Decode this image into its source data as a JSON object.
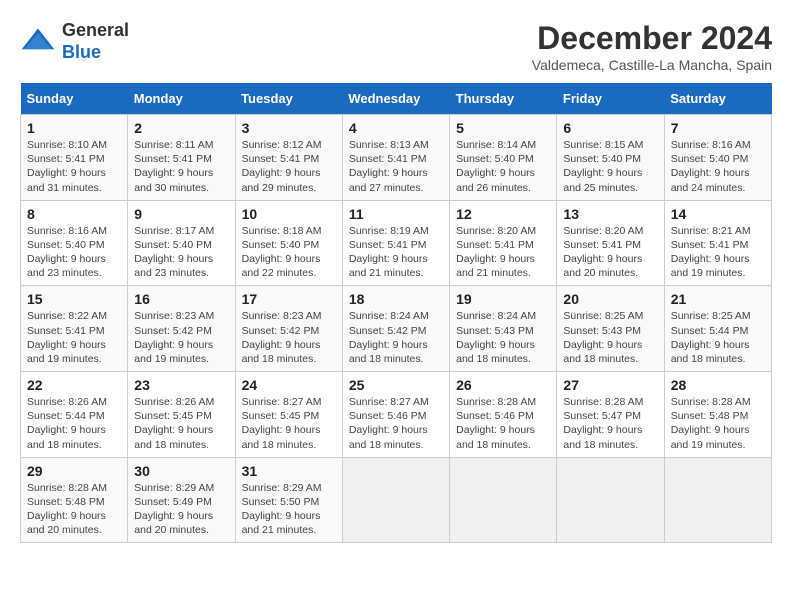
{
  "header": {
    "logo_general": "General",
    "logo_blue": "Blue",
    "month_year": "December 2024",
    "location": "Valdemeca, Castille-La Mancha, Spain"
  },
  "days_of_week": [
    "Sunday",
    "Monday",
    "Tuesday",
    "Wednesday",
    "Thursday",
    "Friday",
    "Saturday"
  ],
  "weeks": [
    [
      {
        "day": "1",
        "sunrise": "8:10 AM",
        "sunset": "5:41 PM",
        "daylight": "9 hours and 31 minutes."
      },
      {
        "day": "2",
        "sunrise": "8:11 AM",
        "sunset": "5:41 PM",
        "daylight": "9 hours and 30 minutes."
      },
      {
        "day": "3",
        "sunrise": "8:12 AM",
        "sunset": "5:41 PM",
        "daylight": "9 hours and 29 minutes."
      },
      {
        "day": "4",
        "sunrise": "8:13 AM",
        "sunset": "5:41 PM",
        "daylight": "9 hours and 27 minutes."
      },
      {
        "day": "5",
        "sunrise": "8:14 AM",
        "sunset": "5:40 PM",
        "daylight": "9 hours and 26 minutes."
      },
      {
        "day": "6",
        "sunrise": "8:15 AM",
        "sunset": "5:40 PM",
        "daylight": "9 hours and 25 minutes."
      },
      {
        "day": "7",
        "sunrise": "8:16 AM",
        "sunset": "5:40 PM",
        "daylight": "9 hours and 24 minutes."
      }
    ],
    [
      {
        "day": "8",
        "sunrise": "8:16 AM",
        "sunset": "5:40 PM",
        "daylight": "9 hours and 23 minutes."
      },
      {
        "day": "9",
        "sunrise": "8:17 AM",
        "sunset": "5:40 PM",
        "daylight": "9 hours and 23 minutes."
      },
      {
        "day": "10",
        "sunrise": "8:18 AM",
        "sunset": "5:40 PM",
        "daylight": "9 hours and 22 minutes."
      },
      {
        "day": "11",
        "sunrise": "8:19 AM",
        "sunset": "5:41 PM",
        "daylight": "9 hours and 21 minutes."
      },
      {
        "day": "12",
        "sunrise": "8:20 AM",
        "sunset": "5:41 PM",
        "daylight": "9 hours and 21 minutes."
      },
      {
        "day": "13",
        "sunrise": "8:20 AM",
        "sunset": "5:41 PM",
        "daylight": "9 hours and 20 minutes."
      },
      {
        "day": "14",
        "sunrise": "8:21 AM",
        "sunset": "5:41 PM",
        "daylight": "9 hours and 19 minutes."
      }
    ],
    [
      {
        "day": "15",
        "sunrise": "8:22 AM",
        "sunset": "5:41 PM",
        "daylight": "9 hours and 19 minutes."
      },
      {
        "day": "16",
        "sunrise": "8:23 AM",
        "sunset": "5:42 PM",
        "daylight": "9 hours and 19 minutes."
      },
      {
        "day": "17",
        "sunrise": "8:23 AM",
        "sunset": "5:42 PM",
        "daylight": "9 hours and 18 minutes."
      },
      {
        "day": "18",
        "sunrise": "8:24 AM",
        "sunset": "5:42 PM",
        "daylight": "9 hours and 18 minutes."
      },
      {
        "day": "19",
        "sunrise": "8:24 AM",
        "sunset": "5:43 PM",
        "daylight": "9 hours and 18 minutes."
      },
      {
        "day": "20",
        "sunrise": "8:25 AM",
        "sunset": "5:43 PM",
        "daylight": "9 hours and 18 minutes."
      },
      {
        "day": "21",
        "sunrise": "8:25 AM",
        "sunset": "5:44 PM",
        "daylight": "9 hours and 18 minutes."
      }
    ],
    [
      {
        "day": "22",
        "sunrise": "8:26 AM",
        "sunset": "5:44 PM",
        "daylight": "9 hours and 18 minutes."
      },
      {
        "day": "23",
        "sunrise": "8:26 AM",
        "sunset": "5:45 PM",
        "daylight": "9 hours and 18 minutes."
      },
      {
        "day": "24",
        "sunrise": "8:27 AM",
        "sunset": "5:45 PM",
        "daylight": "9 hours and 18 minutes."
      },
      {
        "day": "25",
        "sunrise": "8:27 AM",
        "sunset": "5:46 PM",
        "daylight": "9 hours and 18 minutes."
      },
      {
        "day": "26",
        "sunrise": "8:28 AM",
        "sunset": "5:46 PM",
        "daylight": "9 hours and 18 minutes."
      },
      {
        "day": "27",
        "sunrise": "8:28 AM",
        "sunset": "5:47 PM",
        "daylight": "9 hours and 18 minutes."
      },
      {
        "day": "28",
        "sunrise": "8:28 AM",
        "sunset": "5:48 PM",
        "daylight": "9 hours and 19 minutes."
      }
    ],
    [
      {
        "day": "29",
        "sunrise": "8:28 AM",
        "sunset": "5:48 PM",
        "daylight": "9 hours and 20 minutes."
      },
      {
        "day": "30",
        "sunrise": "8:29 AM",
        "sunset": "5:49 PM",
        "daylight": "9 hours and 20 minutes."
      },
      {
        "day": "31",
        "sunrise": "8:29 AM",
        "sunset": "5:50 PM",
        "daylight": "9 hours and 21 minutes."
      },
      null,
      null,
      null,
      null
    ]
  ],
  "labels": {
    "sunrise": "Sunrise:",
    "sunset": "Sunset:",
    "daylight": "Daylight:"
  }
}
